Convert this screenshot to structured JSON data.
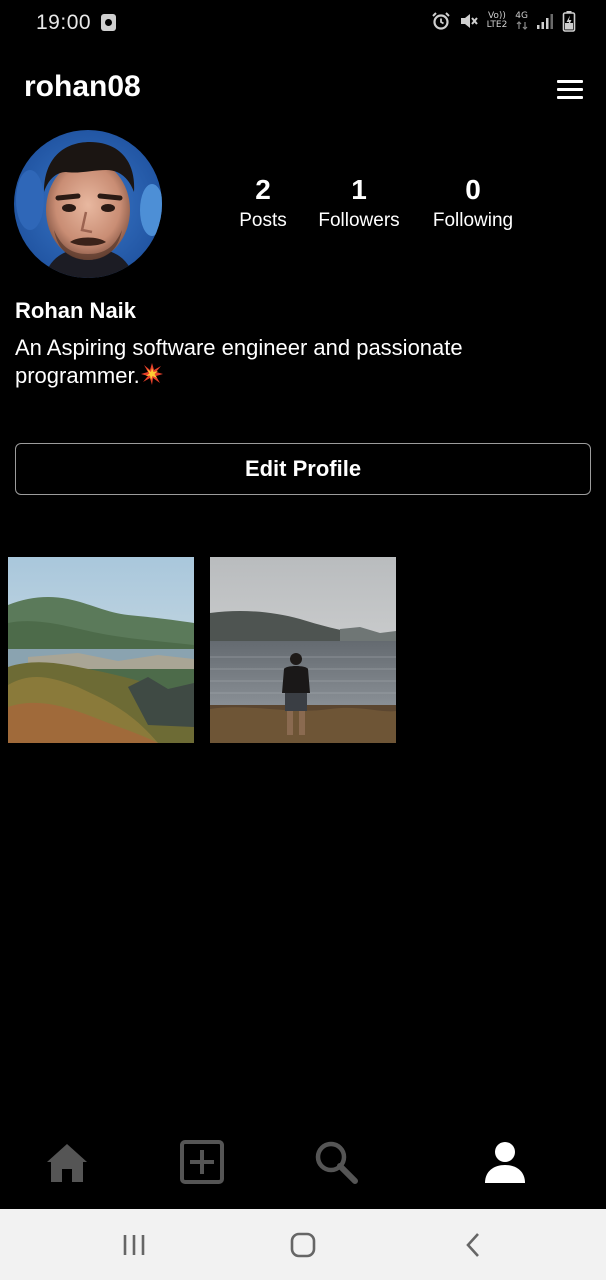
{
  "status_bar": {
    "time": "19:00",
    "network_top": "Vo))",
    "network_bottom": "LTE2",
    "network_type": "4G",
    "icons": [
      "notification-icon",
      "alarm-icon",
      "mute-icon",
      "signal-icon",
      "battery-icon"
    ]
  },
  "header": {
    "username": "rohan08",
    "menu_icon": "hamburger-menu-icon"
  },
  "profile": {
    "stats": [
      {
        "value": "2",
        "label": "Posts"
      },
      {
        "value": "1",
        "label": "Followers"
      },
      {
        "value": "0",
        "label": "Following"
      }
    ],
    "display_name": "Rohan Naik",
    "bio": "An Aspiring software engineer and passionate programmer.",
    "edit_button_label": "Edit Profile"
  },
  "posts": [
    {
      "icon": "mountain-landscape-photo"
    },
    {
      "icon": "lake-person-photo"
    }
  ],
  "bottom_nav": {
    "items": [
      "home-icon",
      "add-post-icon",
      "search-icon",
      "profile-icon"
    ],
    "active": "profile-icon"
  },
  "system_nav": [
    "recent-apps-icon",
    "home-circle-icon",
    "back-icon"
  ],
  "colors": {
    "background": "#000000",
    "text": "#ffffff",
    "inactive_icon": "#555555",
    "button_border": "#9c9c9c",
    "system_nav_bg": "#f2f2f2"
  }
}
